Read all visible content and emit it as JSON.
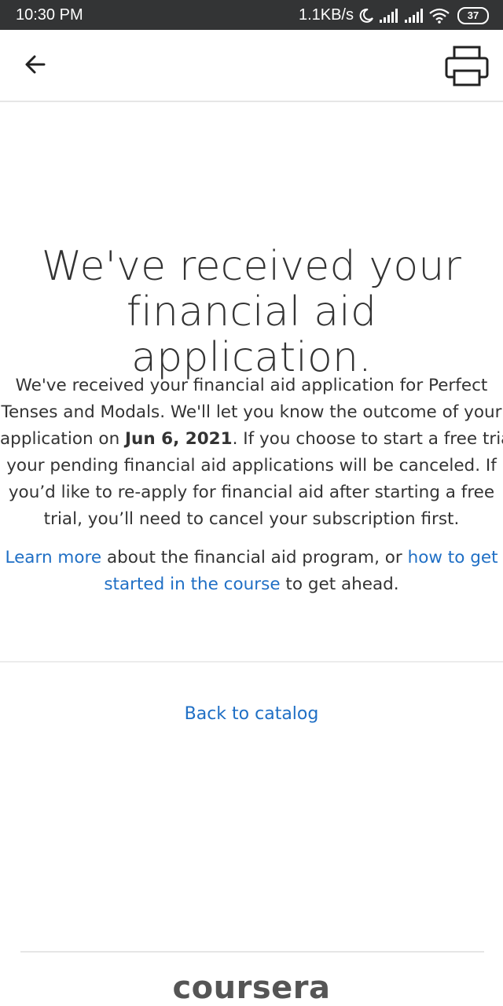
{
  "status_bar": {
    "time": "10:30 PM",
    "speed": "1.1KB/s",
    "battery": "37",
    "icons": [
      "moon-icon",
      "signal-icon",
      "signal-icon",
      "wifi-icon",
      "battery-icon"
    ]
  },
  "app_bar": {
    "back_icon": "arrow-left-icon",
    "print_icon": "printer-icon"
  },
  "headline": {
    "line1": "We've received your",
    "line2": "financial aid application."
  },
  "body": {
    "line1": "We've received your financial aid application for Perfect",
    "line2": "Tenses and Modals. We'll let you know the outcome of your",
    "line3_before": "application on ",
    "line3_date": "Jun 6, 2021",
    "line3_after": ". If you choose to start a free trial,",
    "line4": "your pending financial aid applications will be canceled. If",
    "line5": "you’d like to re-apply for financial aid after starting a free",
    "line6": "trial, you’ll need to cancel your subscription first."
  },
  "links_paragraph": {
    "learn_more": "Learn more",
    "middle": " about the financial aid program, or ",
    "how_to_get_part1": "how to get",
    "how_to_get_part2": "started in the course",
    "end": " to get ahead."
  },
  "back_to_catalog": "Back to catalog",
  "footer": {
    "logo": "coursera"
  },
  "colors": {
    "link": "#1f6fc5",
    "status_bar_bg": "#333435",
    "text": "#333333"
  }
}
